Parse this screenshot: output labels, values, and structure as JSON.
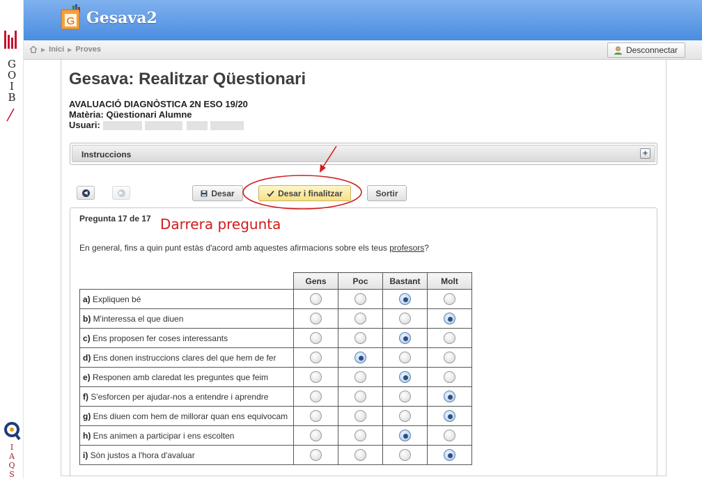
{
  "branding": {
    "goib_letters": [
      "G",
      "O",
      "I",
      "B"
    ],
    "iaqs_letters": [
      "I",
      "A",
      "Q",
      "S"
    ],
    "logo_letter": "G",
    "app_name": "Gesava2"
  },
  "breadcrumb": [
    "Inici",
    "Proves"
  ],
  "header": {
    "logout_label": "Desconnectar"
  },
  "page": {
    "title": "Gesava: Realitzar Qüestionari",
    "exam": "AVALUACIÓ DIAGNÒSTICA 2N ESO 19/20",
    "subject": "Matèria: Qüestionari Alumne",
    "user_label": "Usuari:"
  },
  "instructions": {
    "label": "Instruccions",
    "expand_symbol": "+"
  },
  "toolbar": {
    "save_label": "Desar",
    "save_finish_label": "Desar i finalitzar",
    "exit_label": "Sortir"
  },
  "annotation": {
    "text": "Darrera pregunta"
  },
  "question": {
    "counter": "Pregunta 17 de 17",
    "text_before": "En general, fins a quin punt estàs d'acord amb aquestes afirmacions sobre els teus ",
    "text_underlined": "profesors",
    "text_after": "?"
  },
  "table": {
    "columns": [
      "Gens",
      "Poc",
      "Bastant",
      "Molt"
    ],
    "rows": [
      {
        "key": "a)",
        "label": " Expliquen bé",
        "selected": 2
      },
      {
        "key": "b)",
        "label": " M'interessa el que diuen",
        "selected": 3
      },
      {
        "key": "c)",
        "label": " Ens proposen fer coses interessants",
        "selected": 2
      },
      {
        "key": "d)",
        "label": " Ens donen instruccions clares del que hem de fer",
        "selected": 1
      },
      {
        "key": "e)",
        "label": " Responen amb claredat les preguntes que feim",
        "selected": 2
      },
      {
        "key": "f)",
        "label": " S'esforcen per ajudar-nos a entendre i aprendre",
        "selected": 3
      },
      {
        "key": "g)",
        "label": " Ens diuen com hem de millorar quan ens equivocam",
        "selected": 3
      },
      {
        "key": "h)",
        "label": " Ens animen a participar i ens escolten",
        "selected": 2
      },
      {
        "key": "i)",
        "label": " Són justos a l'hora d'avaluar",
        "selected": 3
      }
    ]
  },
  "colors": {
    "header_blue": "#4b8de0",
    "accent_red": "#d31a1a",
    "goib_red": "#c4122f",
    "primary_button": "#f7e187"
  }
}
